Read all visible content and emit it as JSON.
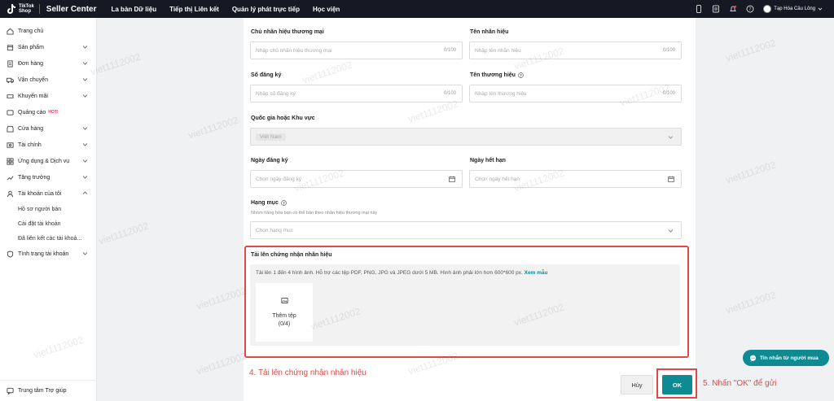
{
  "topbar": {
    "logo_text_1": "TikTok",
    "logo_text_2": "Shop",
    "title": "Seller Center",
    "nav": [
      "La bàn Dữ liệu",
      "Tiếp thị Liên kết",
      "Quản lý phát trực tiếp",
      "Học viện"
    ],
    "shop_name": "Tạp Hóa Câu Lông"
  },
  "sidebar": {
    "items": [
      {
        "label": "Trang chủ",
        "icon": "home-icon",
        "chevron": false
      },
      {
        "label": "Sản phẩm",
        "icon": "box-icon",
        "chevron": true
      },
      {
        "label": "Đơn hàng",
        "icon": "order-icon",
        "chevron": true
      },
      {
        "label": "Vận chuyển",
        "icon": "truck-icon",
        "chevron": true
      },
      {
        "label": "Khuyến mãi",
        "icon": "ticket-icon",
        "chevron": true
      },
      {
        "label": "Quảng cáo",
        "icon": "ads-icon",
        "chevron": false,
        "badge": "HOT!"
      },
      {
        "label": "Cửa hàng",
        "icon": "store-icon",
        "chevron": true
      },
      {
        "label": "Tài chính",
        "icon": "finance-icon",
        "chevron": true
      },
      {
        "label": "Ứng dụng & Dịch vụ",
        "icon": "apps-icon",
        "chevron": true
      },
      {
        "label": "Tăng trưởng",
        "icon": "growth-icon",
        "chevron": true
      },
      {
        "label": "Tài khoản của tôi",
        "icon": "user-icon",
        "chevron": true
      }
    ],
    "subitems": [
      "Hồ sơ người bán",
      "Cài đặt tài khoản",
      "Đã liên kết các tài khoả..."
    ],
    "last_item": "Tình trạng tài khoản",
    "footer": "Trung tâm Trợ giúp"
  },
  "form": {
    "owner_label": "Chủ nhãn hiệu thương mại",
    "owner_placeholder": "Nhập chủ nhãn hiệu thương mại",
    "owner_count": "0/100",
    "brand_name_label": "Tên nhãn hiệu",
    "brand_name_placeholder": "Nhập tên nhãn hiệu",
    "brand_name_count": "0/100",
    "reg_no_label": "Số đăng ký",
    "reg_no_placeholder": "Nhập số đăng ký",
    "reg_no_count": "0/100",
    "trade_name_label": "Tên thương hiệu",
    "trade_name_placeholder": "Nhập tên thương hiệu",
    "trade_name_count": "0/100",
    "country_label": "Quốc gia hoặc Khu vực",
    "country_value": "Việt Nam",
    "reg_date_label": "Ngày đăng ký",
    "reg_date_placeholder": "Chọn ngày đăng ký",
    "exp_date_label": "Ngày hết hạn",
    "exp_date_placeholder": "Chọn ngày hết hạn",
    "category_label": "Hạng mục",
    "category_hint": "Nhóm hàng hóa bạn có thể bán theo nhãn hiệu thương mại này",
    "category_placeholder": "Chọn hạng mục",
    "upload_title": "Tải lên chứng nhận nhãn hiệu",
    "upload_desc": "Tải lên 1 đến 4 hình ảnh. Hỗ trợ các tệp PDF, PNG, JPG và JPEG dưới 5 MB. Hình ảnh phải lớn hơn 600*600 px.",
    "upload_link": "Xem mẫu",
    "add_file_label": "Thêm tệp",
    "add_file_count": "(0/4)"
  },
  "actions": {
    "cancel": "Hủy",
    "ok": "OK"
  },
  "annotations": {
    "step4": "4. Tải lên chứng nhận nhãn hiệu",
    "step5": "5. Nhấn \"OK\" để gửi"
  },
  "chat": {
    "label": "Tin nhắn từ người mua"
  },
  "watermark": "viet1112002",
  "colors": {
    "accent": "#0f8a93",
    "annotation": "#e04848",
    "topbar": "#161823"
  }
}
